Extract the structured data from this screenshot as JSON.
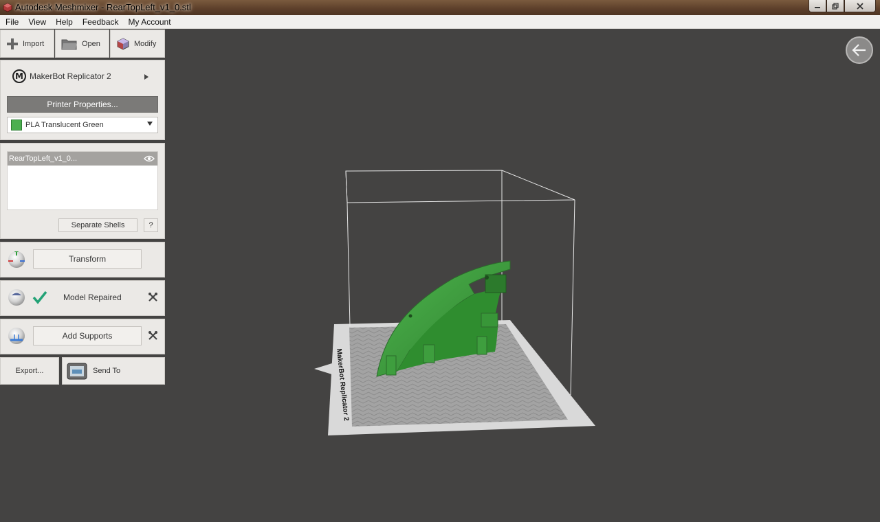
{
  "window": {
    "title": "Autodesk Meshmixer - RearTopLeft_v1_0.stl"
  },
  "menu": {
    "items": [
      "File",
      "View",
      "Help",
      "Feedback",
      "My Account"
    ]
  },
  "toolbar": {
    "import_label": "Import",
    "open_label": "Open",
    "modify_label": "Modify"
  },
  "printer": {
    "name": "MakerBot Replicator 2",
    "properties_label": "Printer Properties...",
    "material": "PLA Translucent Green",
    "material_color": "#4caf50"
  },
  "objects": {
    "items": [
      {
        "name": "RearTopLeft_v1_0..."
      }
    ],
    "separate_shells_label": "Separate Shells",
    "help_label": "?"
  },
  "steps": {
    "transform_label": "Transform",
    "repair_status": "Model Repaired",
    "supports_label": "Add Supports"
  },
  "output": {
    "export_label": "Export...",
    "send_to_label": "Send To"
  },
  "viewport": {
    "build_plate_label": "MakerBot Replicator 2",
    "model_color": "#3f9a3f",
    "plate_color": "#d9d9d9",
    "background_color": "#444342"
  }
}
